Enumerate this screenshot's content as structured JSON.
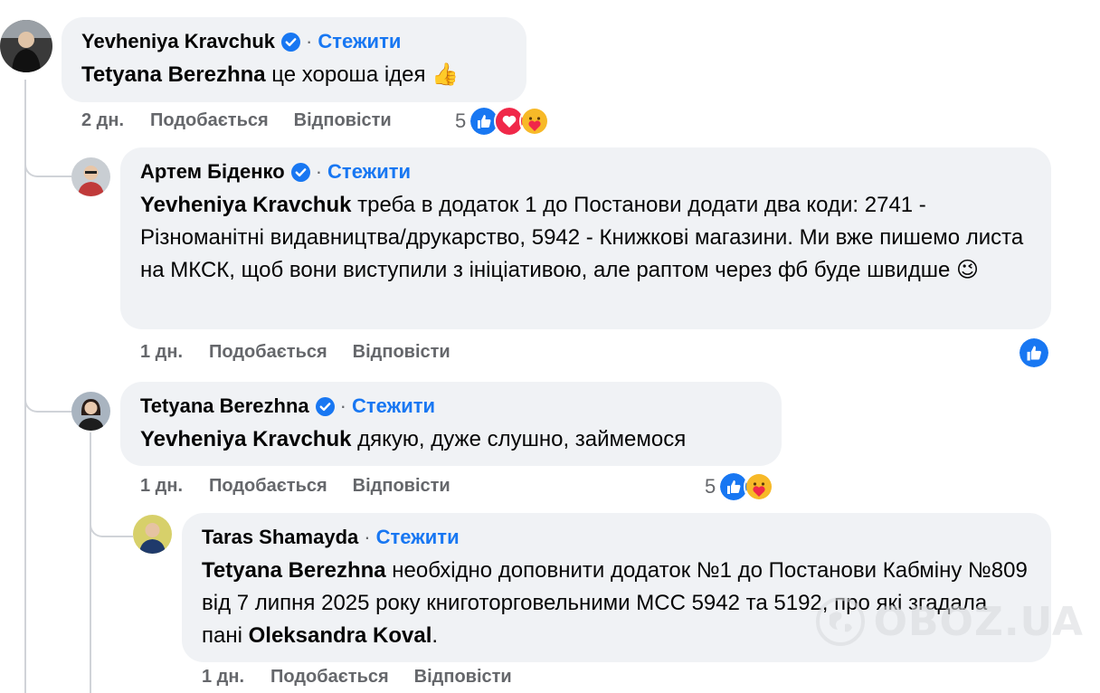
{
  "comments": [
    {
      "author": "Yevheniya Kravchuk",
      "verified": true,
      "follow_label": "Стежити",
      "mention": "Tetyana Berezhna",
      "text": " це хороша ідея 👍",
      "time": "2 дн.",
      "like_label": "Подобається",
      "reply_label": "Відповісти",
      "reaction_count": "5",
      "reactions": [
        "like-icon",
        "love-icon",
        "care-icon"
      ]
    },
    {
      "author": "Артем Біденко",
      "verified": true,
      "follow_label": "Стежити",
      "mention": "Yevheniya Kravchuk",
      "text": " треба в додаток 1 до Постанови додати два коди: 2741 - Різноманітні видавництва/друкарство, 5942 - Книжкові магазини. Ми вже пишемо листа на МКСК, щоб вони виступили з ініціативою, але раптом через фб буде швидше 😉",
      "time": "1 дн.",
      "like_label": "Подобається",
      "reply_label": "Відповісти",
      "reactions": [
        "like-icon"
      ]
    },
    {
      "author": "Tetyana Berezhna",
      "verified": true,
      "follow_label": "Стежити",
      "mention": "Yevheniya Kravchuk",
      "text": " дякую, дуже слушно, займемося",
      "time": "1 дн.",
      "like_label": "Подобається",
      "reply_label": "Відповісти",
      "reaction_count": "5",
      "reactions": [
        "like-icon",
        "care-icon"
      ]
    },
    {
      "author": "Taras Shamayda",
      "verified": false,
      "follow_label": "Стежити",
      "mention": "Tetyana Berezhna",
      "text_part1": " необхідно доповнити додаток №1 до Постанови Кабміну №809 від 7 липня 2025 року книготорговельними МСС 5942 та 5192, про які згадала пані ",
      "mention2": "Oleksandra Koval",
      "text_part2": ".",
      "time": "1 дн.",
      "like_label": "Подобається",
      "reply_label": "Відповісти"
    }
  ],
  "watermark": {
    "text": "OBOZ.UA",
    "icon": "globe-icon"
  },
  "colors": {
    "bubble": "#f0f2f5",
    "link": "#1877f2",
    "meta": "#65676b",
    "like": "#1877f2",
    "love": "#f02849"
  }
}
